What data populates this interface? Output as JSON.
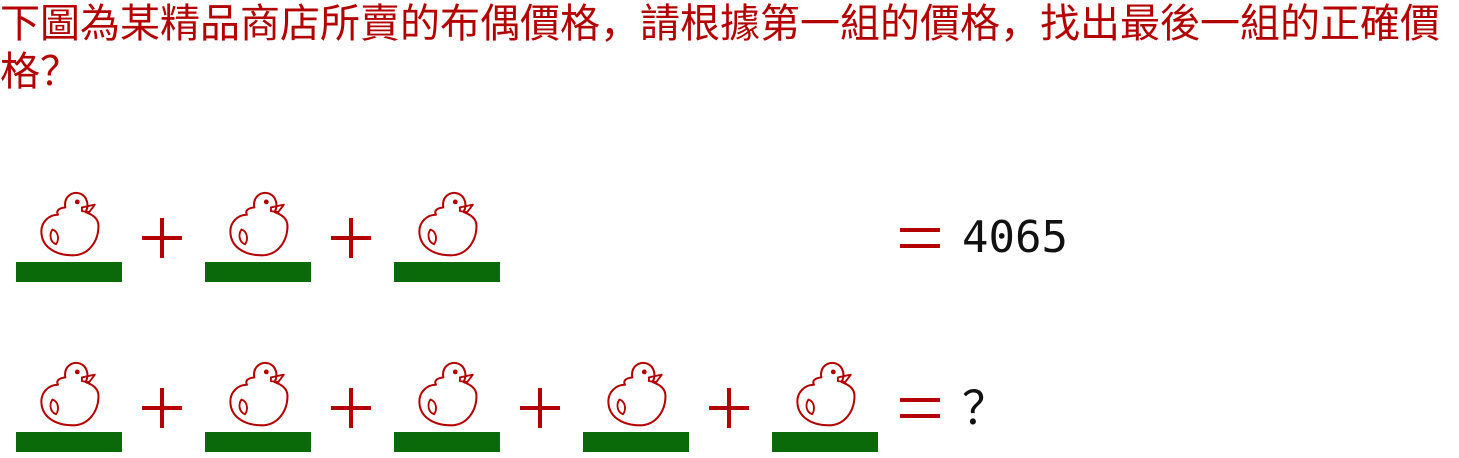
{
  "question": "下圖為某精品商店所賣的布偶價格，請根據第一組的價格，找出最後一組的正確價格？",
  "rows": [
    {
      "duck_count": 3,
      "result": "4065"
    },
    {
      "duck_count": 5,
      "result": "？"
    }
  ],
  "icons": {
    "item": "rubber-duck-outline-icon",
    "operator": "plus-sign",
    "relation": "equals-sign"
  },
  "colors": {
    "text": "#b30000",
    "duck_outline": "#b30000",
    "base": "#0a6a0a",
    "result_text": "#111111",
    "background": "#ffffff"
  }
}
